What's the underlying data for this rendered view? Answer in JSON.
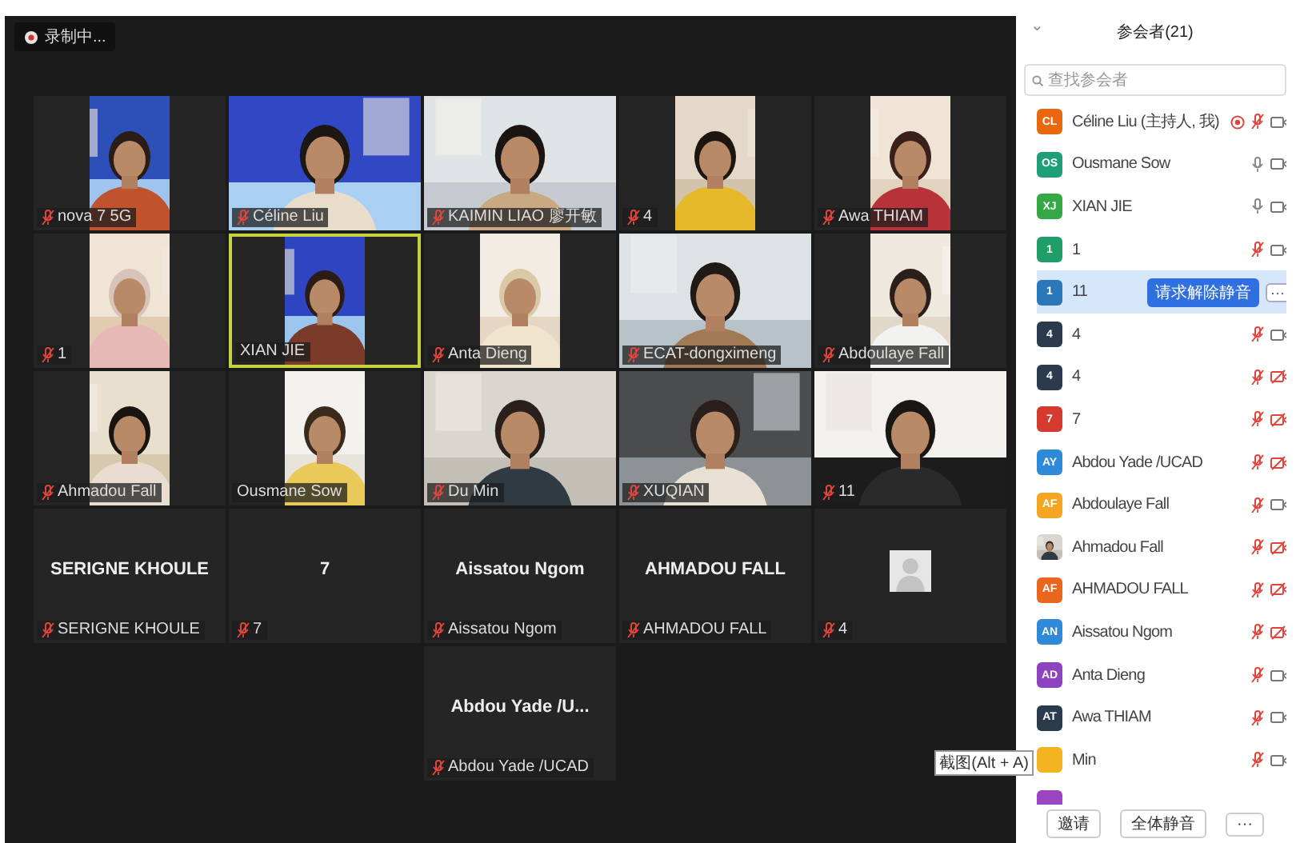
{
  "recording": {
    "label": "录制中..."
  },
  "grid": {
    "rows": [
      {
        "tiles": [
          {
            "kind": "video",
            "portrait": true,
            "label": "nova 7 5G",
            "muted": true,
            "active_speaker": false
          },
          {
            "kind": "video",
            "portrait": false,
            "label": "Céline Liu",
            "muted": true,
            "active_speaker": false
          },
          {
            "kind": "video",
            "portrait": false,
            "label": "KAIMIN LIAO 廖开敏",
            "muted": true,
            "active_speaker": false
          },
          {
            "kind": "video",
            "portrait": true,
            "label": "4",
            "muted": true,
            "active_speaker": false
          },
          {
            "kind": "video",
            "portrait": true,
            "label": "Awa THIAM",
            "muted": true,
            "active_speaker": false
          }
        ]
      },
      {
        "tiles": [
          {
            "kind": "video",
            "portrait": true,
            "label": "1",
            "muted": true,
            "active_speaker": false
          },
          {
            "kind": "video",
            "portrait": true,
            "label": "XIAN JIE",
            "muted": false,
            "active_speaker": true
          },
          {
            "kind": "video",
            "portrait": true,
            "label": "Anta Dieng",
            "muted": true,
            "active_speaker": false
          },
          {
            "kind": "video",
            "portrait": false,
            "label": "ECAT-dongximeng",
            "muted": true,
            "active_speaker": false
          },
          {
            "kind": "video",
            "portrait": true,
            "label": "Abdoulaye Fall",
            "muted": true,
            "active_speaker": false
          }
        ]
      },
      {
        "tiles": [
          {
            "kind": "video",
            "portrait": true,
            "label": "Ahmadou Fall",
            "muted": true,
            "active_speaker": false
          },
          {
            "kind": "video",
            "portrait": true,
            "label": "Ousmane Sow",
            "muted": false,
            "active_speaker": false
          },
          {
            "kind": "video",
            "portrait": false,
            "label": "Du Min",
            "muted": true,
            "active_speaker": false
          },
          {
            "kind": "video",
            "portrait": false,
            "label": "XUQIAN",
            "muted": true,
            "active_speaker": false
          },
          {
            "kind": "video",
            "portrait": false,
            "label": "11",
            "muted": true,
            "active_speaker": false
          }
        ]
      },
      {
        "tiles": [
          {
            "kind": "name",
            "display_name": "SERIGNE KHOULE",
            "label": "SERIGNE KHOULE",
            "muted": true,
            "active_speaker": false
          },
          {
            "kind": "name",
            "display_name": "7",
            "label": "7",
            "muted": true,
            "active_speaker": false
          },
          {
            "kind": "name",
            "display_name": "Aissatou Ngom",
            "label": "Aissatou Ngom",
            "muted": true,
            "active_speaker": false
          },
          {
            "kind": "name",
            "display_name": "AHMADOU FALL",
            "label": "AHMADOU FALL",
            "muted": true,
            "active_speaker": false
          },
          {
            "kind": "avatar",
            "label": "4",
            "muted": true,
            "active_speaker": false
          }
        ]
      },
      {
        "tiles": [
          {
            "kind": "name",
            "display_name": "Abdou Yade /U...",
            "label": "Abdou Yade /UCAD",
            "muted": true,
            "active_speaker": false
          }
        ]
      }
    ]
  },
  "panel": {
    "collapse": "⌄",
    "title": "参会者(21)",
    "search": {
      "placeholder": "查找参会者"
    },
    "participants": [
      {
        "kind": "initials",
        "initials": "CL",
        "color": "#e8670f",
        "name": "Céline Liu (主持人, 我)",
        "recording": true,
        "muted": true,
        "video_off": false,
        "selected": false
      },
      {
        "kind": "initials",
        "initials": "OS",
        "color": "#1e9f78",
        "name": "Ousmane Sow",
        "muted": false,
        "video_off": false,
        "selected": false
      },
      {
        "kind": "initials",
        "initials": "XJ",
        "color": "#34a845",
        "name": "XIAN JIE",
        "muted": false,
        "video_off": false,
        "selected": false
      },
      {
        "kind": "initials",
        "initials": "1",
        "color": "#1f9e6a",
        "name": "1",
        "muted": true,
        "video_off": false,
        "selected": false
      },
      {
        "kind": "initials",
        "initials": "1",
        "color": "#2b78b8",
        "name": "11",
        "selected": true,
        "action": "请求解除静音",
        "more": "···"
      },
      {
        "kind": "initials",
        "initials": "4",
        "color": "#2c3a4e",
        "name": "4",
        "muted": true,
        "video_off": false,
        "selected": false
      },
      {
        "kind": "initials",
        "initials": "4",
        "color": "#2c3a4e",
        "name": "4",
        "muted": true,
        "video_off": true,
        "selected": false
      },
      {
        "kind": "initials",
        "initials": "7",
        "color": "#d43a2f",
        "name": "7",
        "muted": true,
        "video_off": true,
        "selected": false
      },
      {
        "kind": "initials",
        "initials": "AY",
        "color": "#2e8ad8",
        "name": "Abdou Yade /UCAD",
        "muted": true,
        "video_off": true,
        "selected": false
      },
      {
        "kind": "initials",
        "initials": "AF",
        "color": "#f4a521",
        "name": "Abdoulaye Fall",
        "muted": true,
        "video_off": false,
        "selected": false
      },
      {
        "kind": "picture",
        "name": "Ahmadou Fall",
        "muted": true,
        "video_off": true,
        "selected": false
      },
      {
        "kind": "initials",
        "initials": "AF",
        "color": "#e8671c",
        "name": "AHMADOU FALL",
        "muted": true,
        "video_off": true,
        "selected": false
      },
      {
        "kind": "initials",
        "initials": "AN",
        "color": "#2e8ad8",
        "name": "Aissatou Ngom",
        "muted": true,
        "video_off": true,
        "selected": false
      },
      {
        "kind": "initials",
        "initials": "AD",
        "color": "#8e44c0",
        "name": "Anta Dieng",
        "muted": true,
        "video_off": false,
        "selected": false
      },
      {
        "kind": "initials",
        "initials": "AT",
        "color": "#2c3a4e",
        "name": "Awa THIAM",
        "muted": true,
        "video_off": false,
        "selected": false
      },
      {
        "kind": "initials",
        "color": "#f4b321",
        "name": "Min",
        "muted": true,
        "video_off": false,
        "selected": false
      },
      {
        "kind": "initials",
        "color": "#9b45c4",
        "selected": false
      }
    ],
    "tooltip": "截图(Alt + A)",
    "footer": [
      {
        "label": "邀请"
      },
      {
        "label": "全体静音"
      },
      {
        "label": "···"
      }
    ]
  }
}
